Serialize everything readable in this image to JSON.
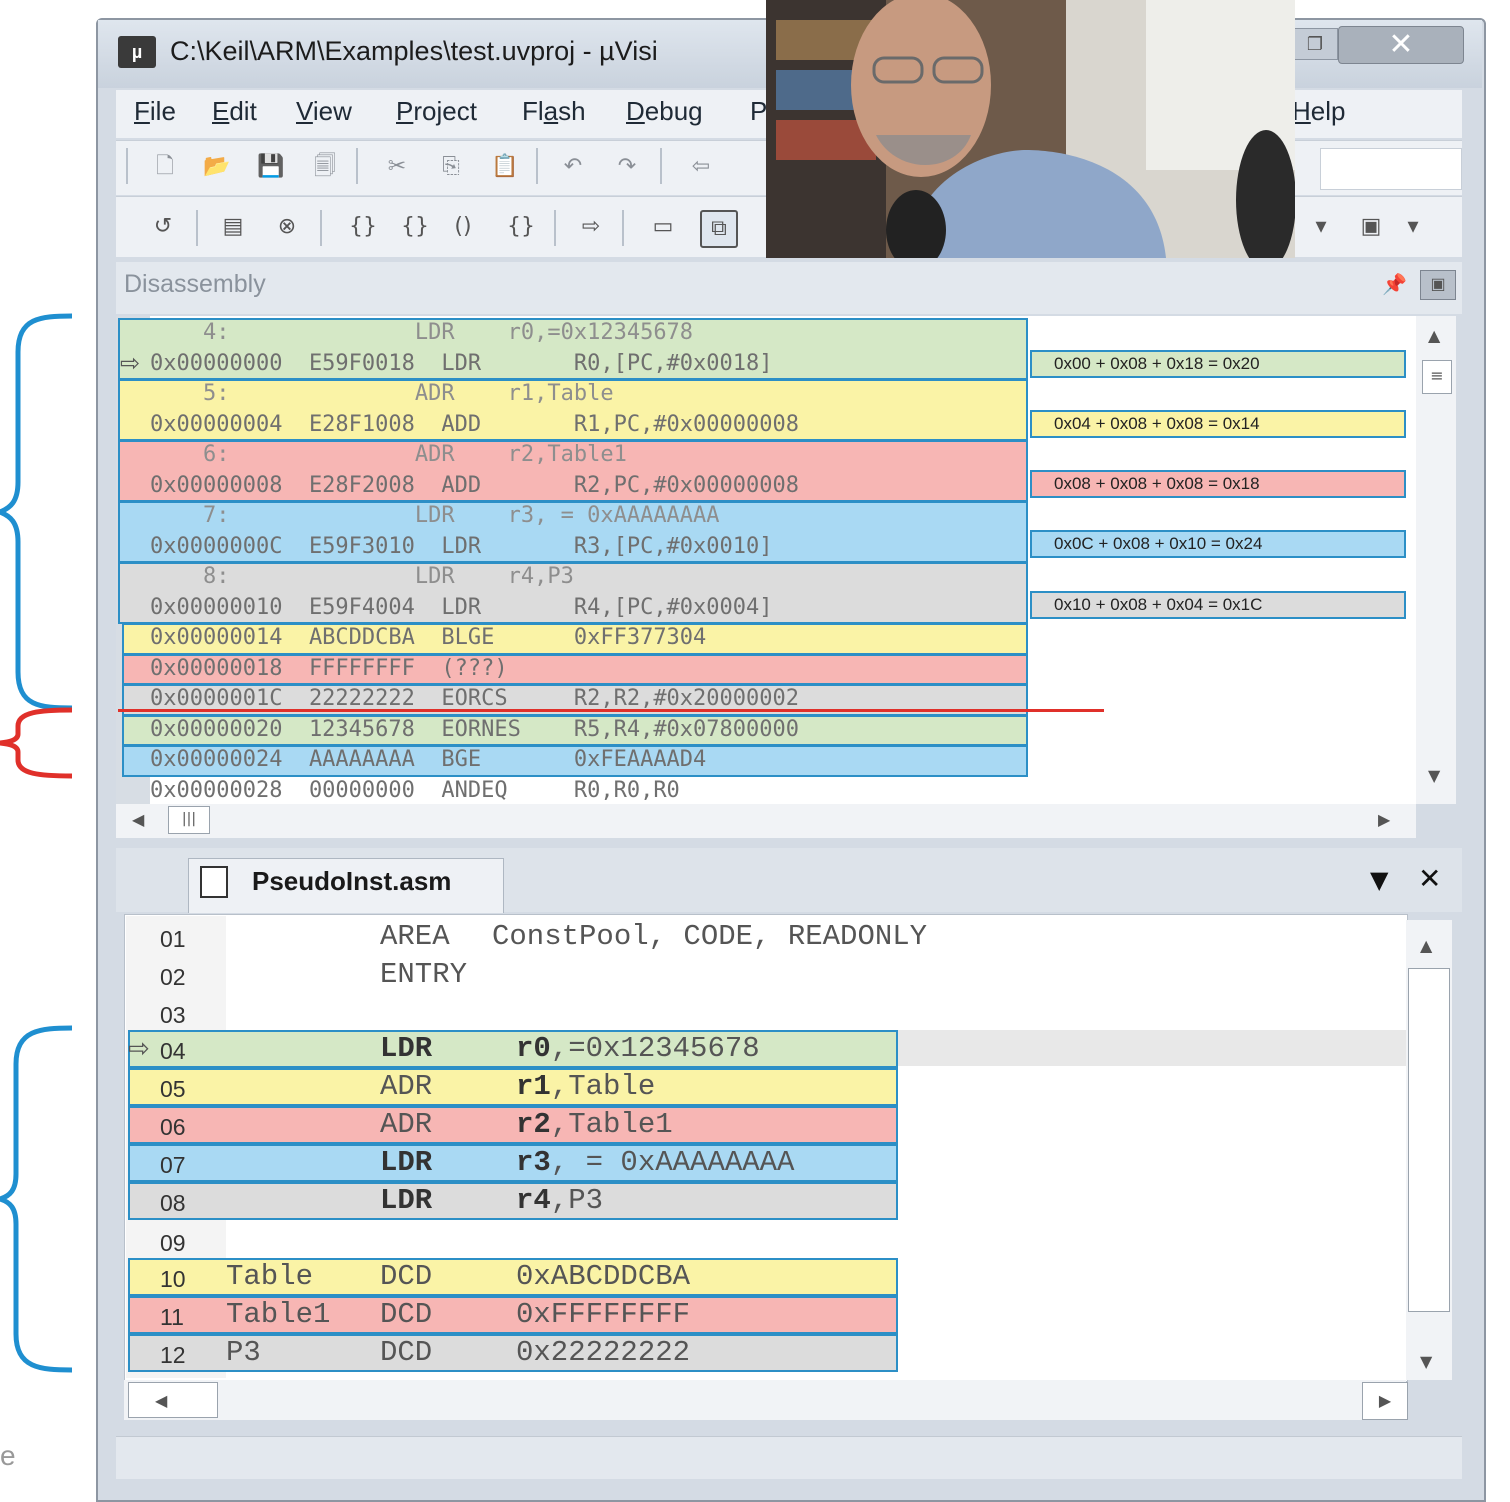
{
  "window": {
    "title": "C:\\Keil\\ARM\\Examples\\test.uvproj - µVisi"
  },
  "menu": [
    "File",
    "Edit",
    "View",
    "Project",
    "Flash",
    "Debug",
    "P",
    "Help"
  ],
  "menu_underline": [
    "F",
    "E",
    "V",
    "P",
    "a",
    "D",
    "",
    "H"
  ],
  "disassembly": {
    "title": "Disassembly",
    "rows": [
      {
        "text": "    4:              LDR    r0,=0x12345678",
        "kind": "src"
      },
      {
        "text": "0x00000000  E59F0018  LDR       R0,[PC,#0x0018]",
        "kind": "asm"
      },
      {
        "text": "    5:              ADR    r1,Table",
        "kind": "src"
      },
      {
        "text": "0x00000004  E28F1008  ADD       R1,PC,#0x00000008",
        "kind": "asm"
      },
      {
        "text": "    6:              ADR    r2,Table1",
        "kind": "src"
      },
      {
        "text": "0x00000008  E28F2008  ADD       R2,PC,#0x00000008",
        "kind": "asm"
      },
      {
        "text": "    7:              LDR    r3, = 0xAAAAAAAA",
        "kind": "src"
      },
      {
        "text": "0x0000000C  E59F3010  LDR       R3,[PC,#0x0010]",
        "kind": "asm"
      },
      {
        "text": "    8:              LDR    r4,P3",
        "kind": "src"
      },
      {
        "text": "0x00000010  E59F4004  LDR       R4,[PC,#0x0004]",
        "kind": "asm"
      },
      {
        "text": "0x00000014  ABCDDCBA  BLGE      0xFF377304",
        "kind": "asm"
      },
      {
        "text": "0x00000018  FFFFFFFF  (???)",
        "kind": "asm"
      },
      {
        "text": "0x0000001C  22222222  EORCS     R2,R2,#0x20000002",
        "kind": "asm"
      },
      {
        "text": "0x00000020  12345678  EORNES    R5,R4,#0x07800000",
        "kind": "asm"
      },
      {
        "text": "0x00000024  AAAAAAAA  BGE       0xFEAAAAD4",
        "kind": "asm"
      },
      {
        "text": "0x00000028  00000000  ANDEQ     R0,R0,R0",
        "kind": "asm"
      }
    ],
    "notes": [
      "0x00 + 0x08 + 0x18 = 0x20",
      "0x04 + 0x08 + 0x08 = 0x14",
      "0x08 + 0x08 + 0x08 = 0x18",
      "0x0C + 0x08 + 0x10 = 0x24",
      "0x10 + 0x08 + 0x04 = 0x1C"
    ]
  },
  "editor": {
    "tab": "PseudoInst.asm",
    "lines": [
      {
        "num": "01",
        "label": "",
        "op": "AREA",
        "args": "ConstPool, CODE, READONLY"
      },
      {
        "num": "02",
        "label": "",
        "op": "ENTRY",
        "args": ""
      },
      {
        "num": "03",
        "label": "",
        "op": "",
        "args": ""
      },
      {
        "num": "04",
        "label": "",
        "op": "LDR",
        "args": "r0,=0x12345678"
      },
      {
        "num": "05",
        "label": "",
        "op": "ADR",
        "args": "r1,Table"
      },
      {
        "num": "06",
        "label": "",
        "op": "ADR",
        "args": "r2,Table1"
      },
      {
        "num": "07",
        "label": "",
        "op": "LDR",
        "args": "r3, = 0xAAAAAAAA"
      },
      {
        "num": "08",
        "label": "",
        "op": "LDR",
        "args": "r4,P3"
      },
      {
        "num": "09",
        "label": "",
        "op": "",
        "args": ""
      },
      {
        "num": "10",
        "label": "Table",
        "op": "DCD",
        "args": "0xABCDDCBA"
      },
      {
        "num": "11",
        "label": "Table1",
        "op": "DCD",
        "args": "0xFFFFFFFF"
      },
      {
        "num": "12",
        "label": "P3",
        "op": "DCD",
        "args": "0x22222222"
      }
    ]
  },
  "edge_text": "e",
  "colors": {
    "green": "#d5e8c6",
    "yellow": "#faf3a6",
    "red": "#f7b6b4",
    "blue": "#a9d9f3",
    "gray": "#dcdcdc",
    "outline": "#2c8fc6",
    "brace_blue": "#1f8fd0",
    "brace_red": "#e0302a"
  }
}
